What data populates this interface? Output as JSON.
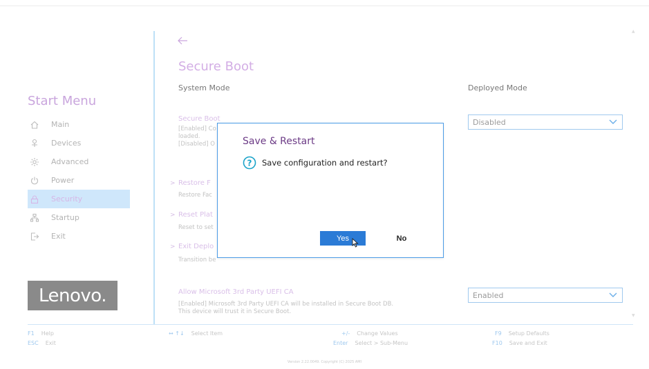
{
  "sidebar": {
    "title": "Start Menu",
    "items": [
      {
        "label": "Main",
        "icon": "home-icon",
        "active": false
      },
      {
        "label": "Devices",
        "icon": "devices-icon",
        "active": false
      },
      {
        "label": "Advanced",
        "icon": "advanced-gear-icon",
        "active": false
      },
      {
        "label": "Power",
        "icon": "power-icon",
        "active": false
      },
      {
        "label": "Security",
        "icon": "lock-icon",
        "active": true
      },
      {
        "label": "Startup",
        "icon": "startup-icon",
        "active": false
      },
      {
        "label": "Exit",
        "icon": "exit-icon",
        "active": false
      }
    ],
    "logo": "Lenovo."
  },
  "main": {
    "title": "Secure Boot",
    "system_mode_label": "System Mode",
    "system_mode_value": "Deployed Mode",
    "secure_boot": {
      "title": "Secure Boot",
      "desc_line1": "[Enabled] Co",
      "desc_line2": "loaded.",
      "desc_line3": "[Disabled] O",
      "value": "Disabled"
    },
    "restore": {
      "title": "Restore F",
      "desc": "Restore Fac"
    },
    "reset": {
      "title": "Reset Plat",
      "desc": "Reset to set"
    },
    "exit_deployed": {
      "title": "Exit Deplo",
      "desc": "Transition be"
    },
    "third_party": {
      "title": "Allow Microsoft 3rd Party UEFI CA",
      "desc_line1": "[Enabled] Microsoft 3rd Party UEFI CA will be installed in Secure Boot DB.",
      "desc_line2": "This device will trust it in Secure Boot.",
      "value": "Enabled"
    }
  },
  "dialog": {
    "title": "Save & Restart",
    "message": "Save configuration and restart?",
    "yes_label": "Yes",
    "no_label": "No",
    "title_color": "#6c3b86",
    "accent": "#2b7bd6"
  },
  "footer": {
    "help_key": "F1",
    "help": "Help",
    "exit_key": "ESC",
    "exit": "Exit",
    "select_item_keys": "↔ ↑↓",
    "select_item": "Select Item",
    "change_key": "+/-",
    "change": "Change Values",
    "enter_key": "Enter",
    "submenu": "Select > Sub-Menu",
    "defaults_key": "F9",
    "defaults": "Setup Defaults",
    "save_key": "F10",
    "save": "Save and Exit",
    "version": "Version 2.22.0049. Copyright (C) 2025 AMI"
  }
}
